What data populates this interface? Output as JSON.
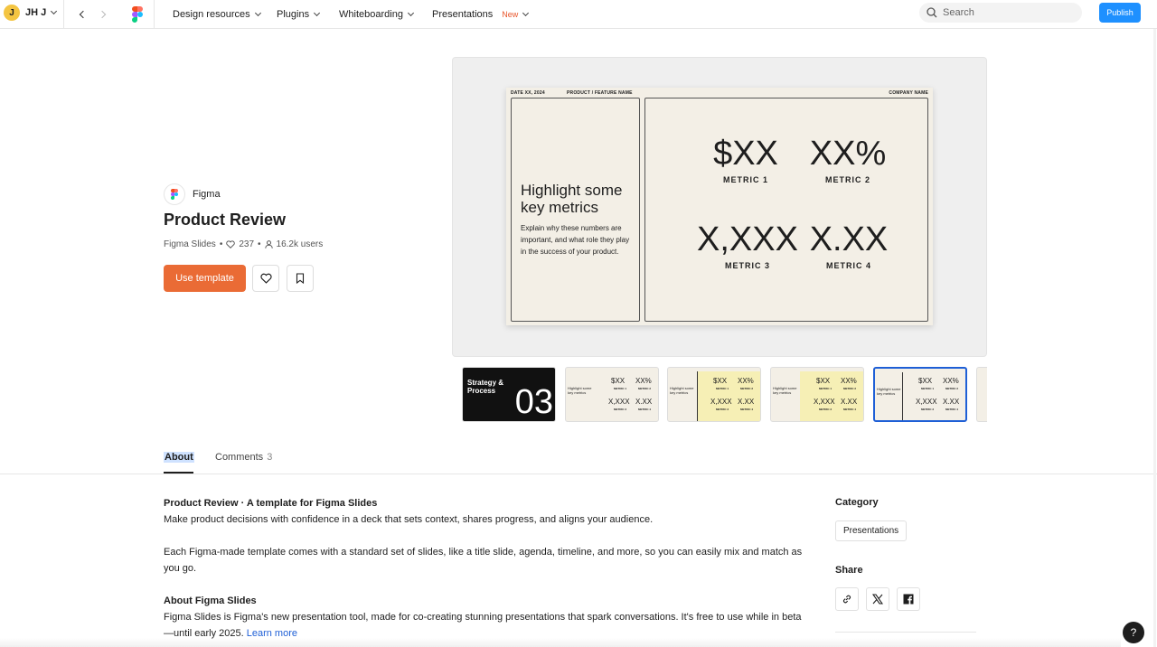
{
  "user": {
    "initial": "J",
    "name": "JH J"
  },
  "nav": {
    "menus": [
      {
        "label": "Design resources"
      },
      {
        "label": "Plugins"
      },
      {
        "label": "Whiteboarding"
      },
      {
        "label": "Presentations",
        "badge": "New"
      }
    ],
    "search_placeholder": "Search",
    "publish_label": "Publish"
  },
  "template": {
    "creator": "Figma",
    "title": "Product Review",
    "product": "Figma Slides",
    "likes": "237",
    "users": "16.2k users",
    "use_label": "Use template"
  },
  "slide": {
    "date": "DATE XX, 2024",
    "product": "PRODUCT / FEATURE NAME",
    "company": "COMPANY NAME",
    "heading": "Highlight some key metrics",
    "body": "Explain why these numbers are important, and what role they play in the success of your product.",
    "metrics": [
      {
        "value": "$XX",
        "label": "METRIC 1"
      },
      {
        "value": "XX%",
        "label": "METRIC 2"
      },
      {
        "value": "X,XXX",
        "label": "METRIC 3"
      },
      {
        "value": "X.XX",
        "label": "METRIC 4"
      }
    ]
  },
  "thumbnails": {
    "first": {
      "title": "Strategy & Process",
      "number": "03"
    },
    "mini_heading": "Highlight some key metrics",
    "v1": "$XX",
    "v2": "XX%",
    "v3": "X,XXX",
    "v4": "X.XX",
    "l1": "METRIC 1",
    "l2": "METRIC 2",
    "l3": "METRIC 3",
    "l4": "METRIC 4"
  },
  "tabs": {
    "about": "About",
    "comments": "Comments",
    "comments_count": "3"
  },
  "about": {
    "heading1": "Product Review · A template for Figma Slides",
    "para1": "Make product decisions with confidence in a deck that sets context, shares progress, and aligns your audience.",
    "para2": "Each Figma-made template comes with a standard set of slides, like a title slide, agenda, timeline, and more, so you can easily mix and match as you go.",
    "heading2": "About Figma Slides",
    "para3": "Figma Slides is Figma's new presentation tool, made for co-creating stunning presentations that spark conversations. It's free to use while in beta—until early 2025.",
    "learn_more": "Learn more"
  },
  "sidebar": {
    "category_heading": "Category",
    "category": "Presentations",
    "share_heading": "Share"
  },
  "help": "?"
}
